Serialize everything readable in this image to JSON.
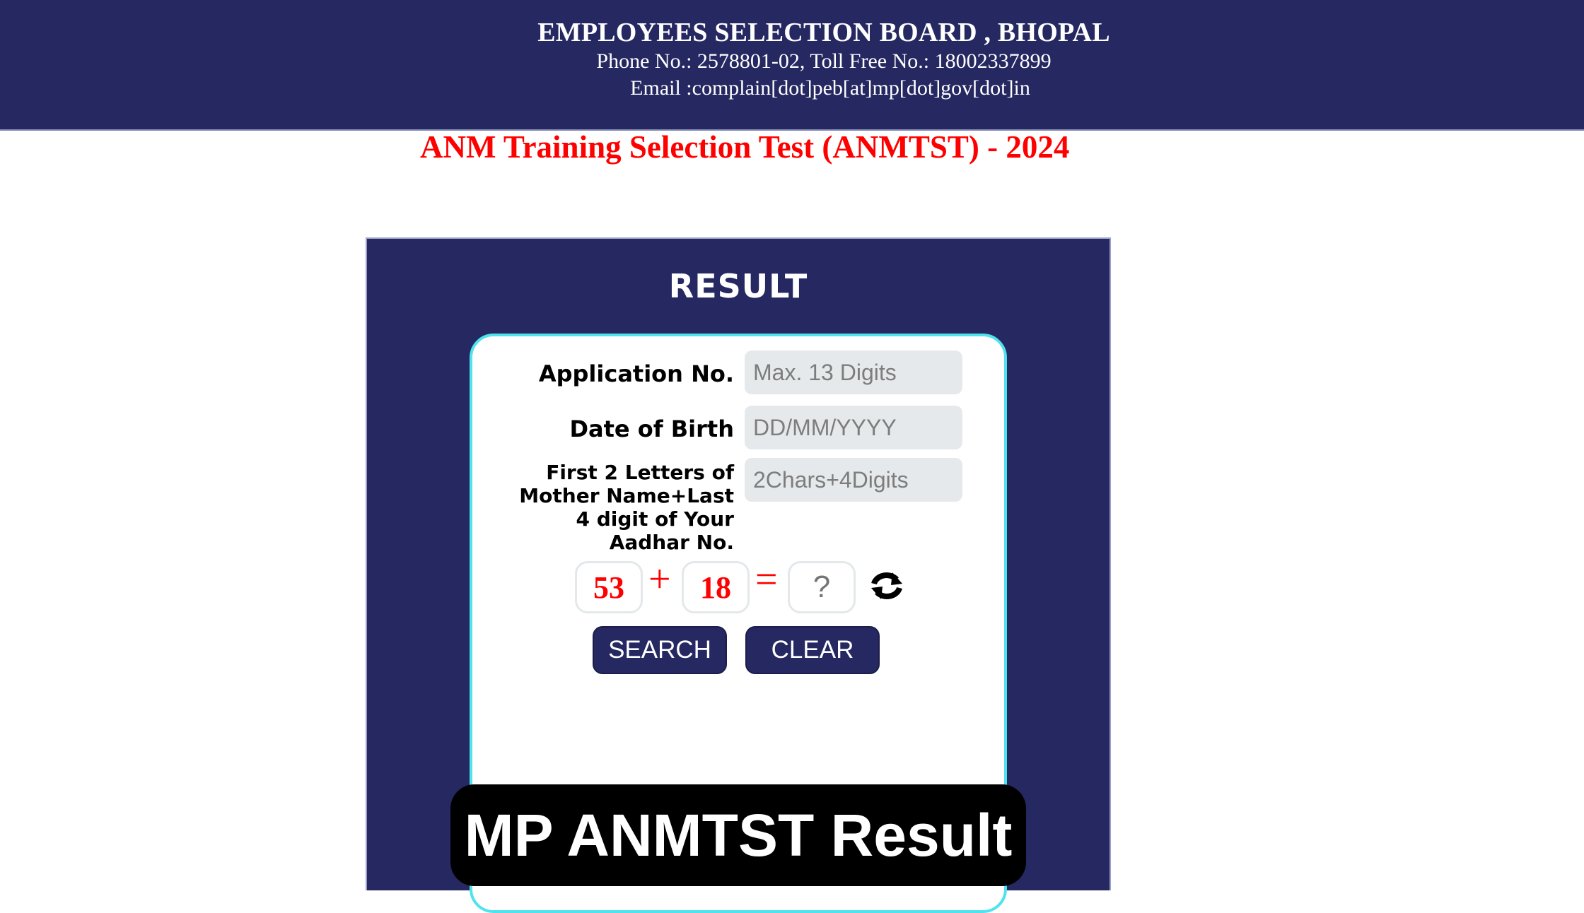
{
  "header": {
    "organization": "EMPLOYEES SELECTION BOARD , BHOPAL",
    "phone": "Phone No.: 2578801-02, Toll Free No.: 18002337899",
    "email": "Email :complain[dot]peb[at]mp[dot]gov[dot]in",
    "background_color": "#262862"
  },
  "exam_title": "ANM Training Selection Test (ANMTST) - 2024",
  "result_panel": {
    "title": "RESULT",
    "fields": [
      {
        "label": "Application No.",
        "placeholder": "Max. 13 Digits",
        "value": ""
      },
      {
        "label": "Date of Birth",
        "placeholder": "DD/MM/YYYY",
        "value": ""
      },
      {
        "label": "First 2 Letters of Mother Name+Last 4 digit of Your Aadhar No.",
        "placeholder": "2Chars+4Digits",
        "value": ""
      }
    ],
    "captcha": {
      "operand_1": "53",
      "operator": "+",
      "operand_2": "18",
      "equals": "=",
      "answer_placeholder": "?",
      "refresh_icon": "refresh-icon"
    },
    "buttons": {
      "search": "SEARCH",
      "clear": "CLEAR"
    },
    "accent_color": "#4fe3ee"
  },
  "overlay_banner": "MP ANMTST Result"
}
